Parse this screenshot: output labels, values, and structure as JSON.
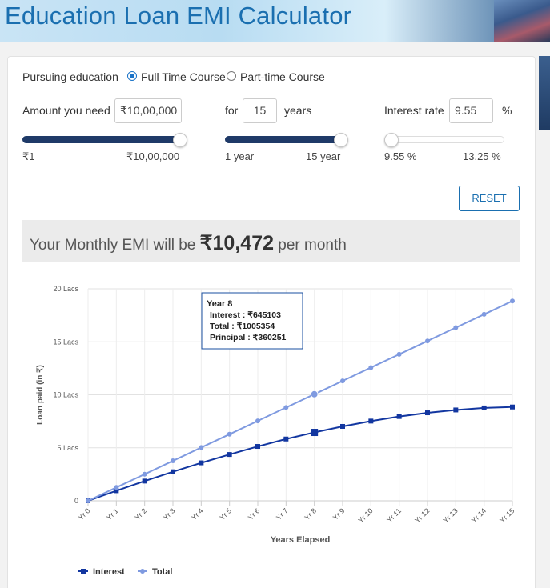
{
  "header": {
    "title": "Education Loan EMI Calculator"
  },
  "course": {
    "label": "Pursuing education",
    "options": [
      {
        "label": "Full Time Course",
        "selected": true
      },
      {
        "label": "Part-time Course",
        "selected": false
      }
    ]
  },
  "amount": {
    "label": "Amount you need",
    "value": "₹10,00,000",
    "min_label": "₹1",
    "max_label": "₹10,00,000",
    "slider_fraction": 1.0
  },
  "tenure": {
    "label_before": "for",
    "value": "15",
    "label_after": "years",
    "min_label": "1 year",
    "max_label": "15 year",
    "slider_fraction": 1.0
  },
  "interest": {
    "label": "Interest rate",
    "value": "9.55",
    "unit": "%",
    "min_label": "9.55 %",
    "max_label": "13.25 %",
    "slider_fraction": 0.0
  },
  "reset_label": "RESET",
  "emi": {
    "prefix": "Your Monthly EMI will be",
    "amount": "₹10,472",
    "suffix": "per month"
  },
  "tooltip": {
    "title": "Year 8",
    "lines": [
      "Interest : ₹645103",
      "Total : ₹1005354",
      "Principal : ₹360251"
    ]
  },
  "colors": {
    "interest": "#1236a0",
    "total": "#7f9ae0",
    "accent": "#1a6fb0",
    "slider": "#1f3a68"
  },
  "chart_data": {
    "type": "line",
    "title": "",
    "xlabel": "Years Elapsed",
    "ylabel": "Loan paid (in ₹)",
    "ylim": [
      0,
      2000000
    ],
    "yticks": [
      {
        "value": 0,
        "label": "0"
      },
      {
        "value": 500000,
        "label": "5 Lacs"
      },
      {
        "value": 1000000,
        "label": "10 Lacs"
      },
      {
        "value": 1500000,
        "label": "15 Lacs"
      },
      {
        "value": 2000000,
        "label": "20 Lacs"
      }
    ],
    "categories": [
      "Yr 0",
      "Yr 1",
      "Yr 2",
      "Yr 3",
      "Yr 4",
      "Yr 5",
      "Yr 6",
      "Yr 7",
      "Yr 8",
      "Yr 9",
      "Yr 10",
      "Yr 11",
      "Yr 12",
      "Yr 13",
      "Yr 14",
      "Yr 15"
    ],
    "series": [
      {
        "name": "Interest",
        "values": [
          0,
          95000,
          186000,
          274000,
          358000,
          437000,
          513000,
          583000,
          645103,
          702000,
          752000,
          795000,
          830000,
          857000,
          876000,
          885000
        ]
      },
      {
        "name": "Total",
        "values": [
          0,
          126000,
          251000,
          377000,
          503000,
          628000,
          754000,
          880000,
          1005354,
          1131000,
          1257000,
          1382000,
          1508000,
          1634000,
          1759000,
          1885000
        ]
      }
    ],
    "grid": true,
    "legend": "bottom-left"
  }
}
